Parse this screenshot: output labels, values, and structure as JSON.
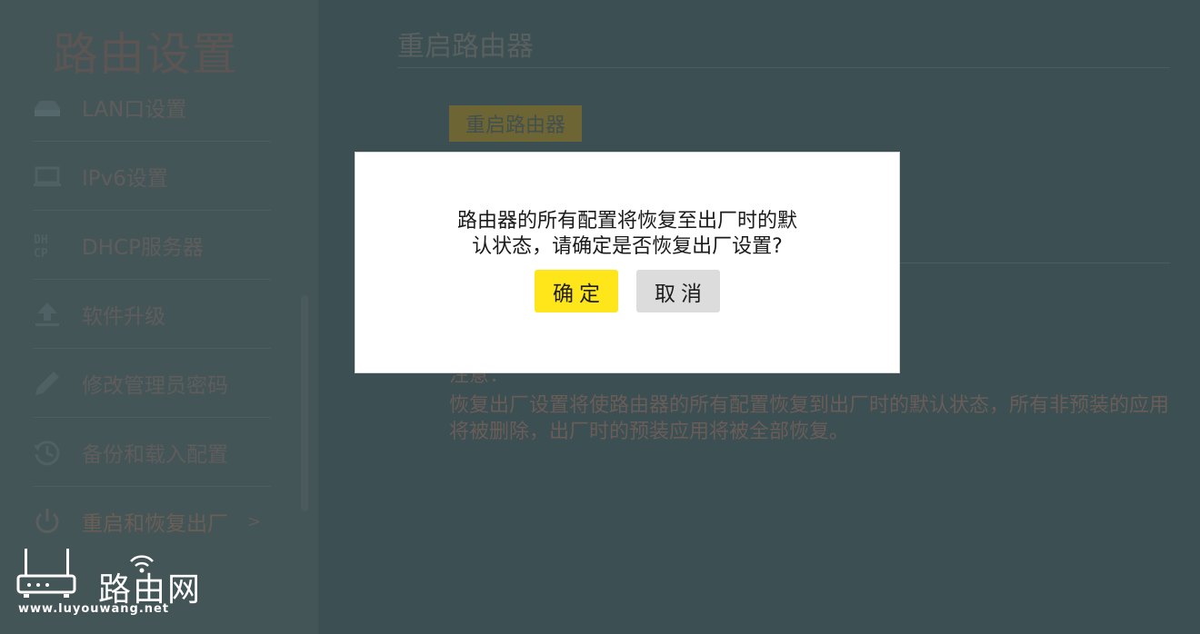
{
  "sidebar": {
    "title": "路由设置",
    "items": [
      {
        "label": "LAN口设置",
        "icon": "house-icon"
      },
      {
        "label": "IPv6设置",
        "icon": "laptop-icon"
      },
      {
        "label": "DHCP服务器",
        "icon": "dhcp-icon"
      },
      {
        "label": "软件升级",
        "icon": "upload-icon"
      },
      {
        "label": "修改管理员密码",
        "icon": "pencil-icon"
      },
      {
        "label": "备份和载入配置",
        "icon": "history-icon"
      },
      {
        "label": "重启和恢复出厂",
        "icon": "power-icon",
        "arrow": ">"
      }
    ]
  },
  "main": {
    "title": "重启路由器",
    "reboot_button": "重启路由器",
    "note_heading": "注意：",
    "note_text": "恢复出厂设置将使路由器的所有配置恢复到出厂时的默认状态，所有非预装的应用将被删除，出厂时的预装应用将被全部恢复。"
  },
  "dialog": {
    "message_line1": "路由器的所有配置将恢复至出厂时的默",
    "message_line2": "认状态，请确定是否恢复出厂设置?",
    "confirm_label": "确定",
    "cancel_label": "取消"
  },
  "watermark": {
    "brand": "路由网",
    "url": "www.luyouwang.net"
  },
  "colors": {
    "overlay_bg": "#3c4f53",
    "confirm": "#ffe61a",
    "cancel": "#dcdcdc",
    "dialog_bg": "#ffffff"
  }
}
